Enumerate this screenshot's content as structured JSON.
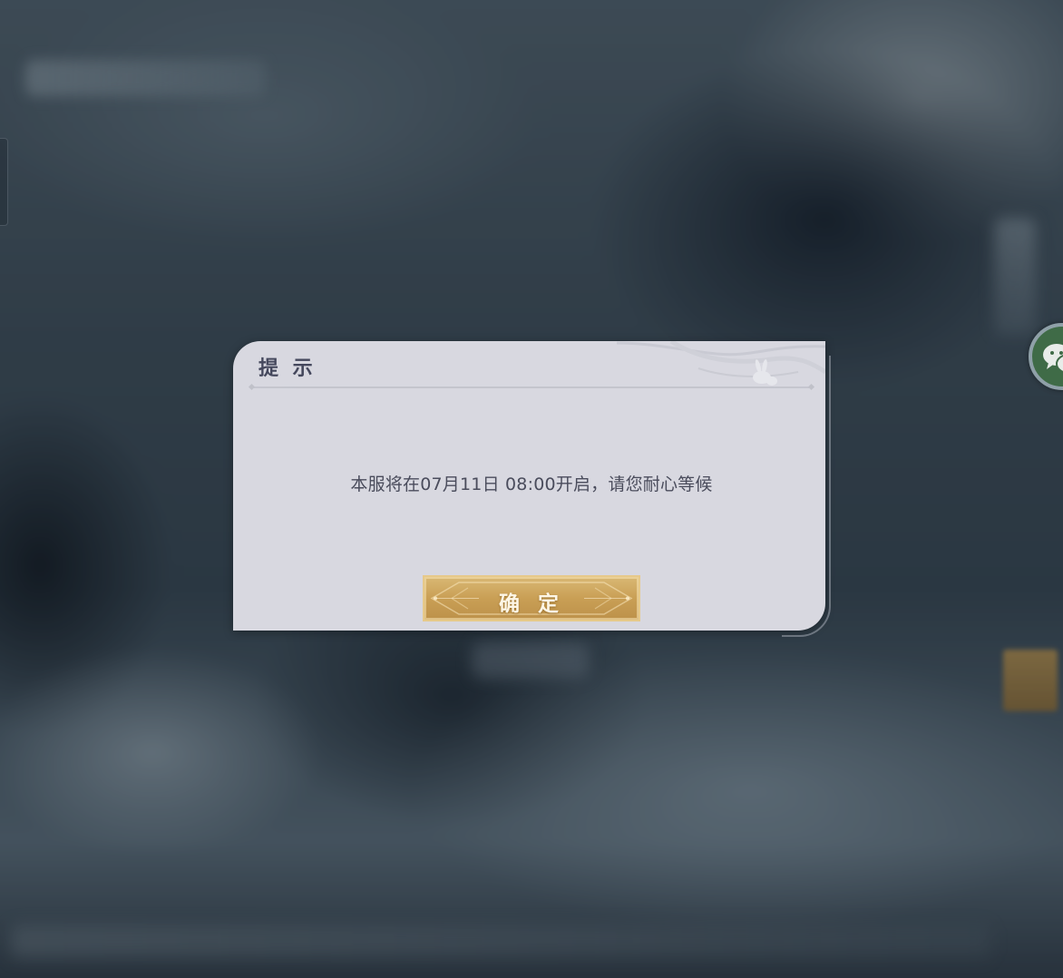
{
  "dialog": {
    "title": "提 示",
    "message": "本服将在07月11日 08:00开启，请您耐心等候",
    "confirm_label": "确 定"
  },
  "icons": {
    "floating_button": "wechat-icon",
    "dialog_corner": "rabbit-cloud-ornament-icon"
  },
  "colors": {
    "dialog_bg": "#d8d8e0",
    "title_text": "#45485d",
    "message_text": "#4a4c5c",
    "button_gold": "#c99f55",
    "button_text": "#fdf6e6",
    "wechat_green": "#3f6b47"
  }
}
